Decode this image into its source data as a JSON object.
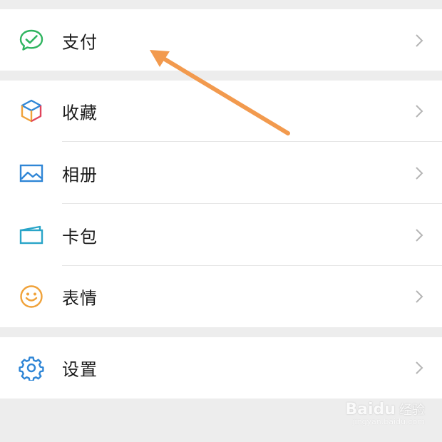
{
  "menu": {
    "pay": {
      "label": "支付",
      "icon": "wechat-pay-icon"
    },
    "favorites": {
      "label": "收藏",
      "icon": "cube-icon"
    },
    "album": {
      "label": "相册",
      "icon": "photo-icon"
    },
    "cards": {
      "label": "卡包",
      "icon": "wallet-icon"
    },
    "stickers": {
      "label": "表情",
      "icon": "smiley-icon"
    },
    "settings": {
      "label": "设置",
      "icon": "gear-icon"
    }
  },
  "annotation": {
    "icon": "orange-arrow-icon",
    "color": "#f29a4e"
  },
  "watermark": {
    "brand": "Bai",
    "brand_suffix": "du",
    "brand_cn": "经验",
    "url": "jingyan.baidu.com"
  },
  "colors": {
    "background": "#ededed",
    "surface": "#ffffff",
    "pay_green": "#2fb45f",
    "accent_blue": "#2f86d6",
    "sticker_orange": "#f0a23a"
  }
}
